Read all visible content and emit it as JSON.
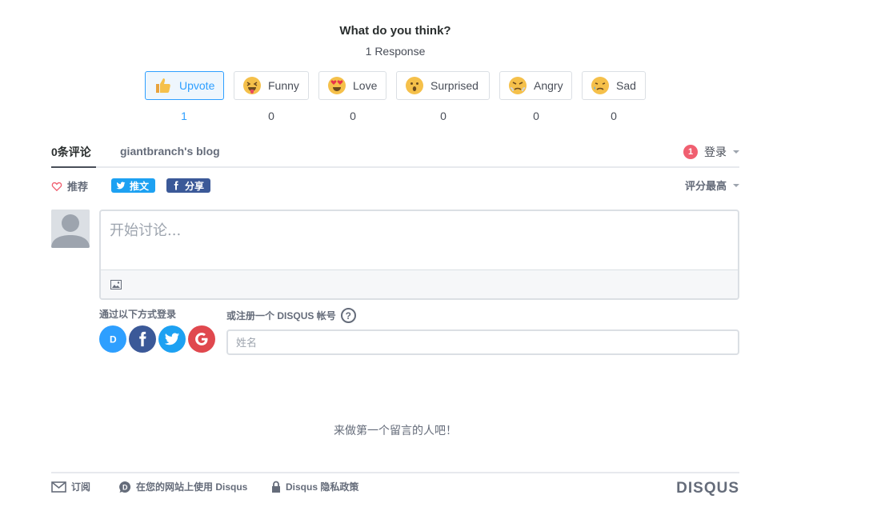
{
  "reactions_header": {
    "title": "What do you think?",
    "response_count": "1 Response"
  },
  "reactions": [
    {
      "label": "Upvote",
      "count": "1",
      "icon": "thumbs-up-icon",
      "selected": true
    },
    {
      "label": "Funny",
      "count": "0",
      "icon": "funny-face-icon"
    },
    {
      "label": "Love",
      "count": "0",
      "icon": "love-face-icon"
    },
    {
      "label": "Surprised",
      "count": "0",
      "icon": "surprised-face-icon"
    },
    {
      "label": "Angry",
      "count": "0",
      "icon": "angry-face-icon"
    },
    {
      "label": "Sad",
      "count": "0",
      "icon": "sad-face-icon"
    }
  ],
  "tabs": {
    "comments": "0条评论",
    "community": "giantbranch's blog",
    "login_badge": "1",
    "login": "登录"
  },
  "actions": {
    "recommend": "推荐",
    "tweet": "推文",
    "share": "分享",
    "sort": "评分最高"
  },
  "editor": {
    "placeholder": "开始讨论..."
  },
  "auth": {
    "login_via": "通过以下方式登录",
    "signup_prefix": "或注册一个 ",
    "signup_brand": "DISQUS",
    "signup_suffix": " 帐号",
    "help": "?",
    "name_placeholder": "姓名"
  },
  "empty_state": "来做第一个留言的人吧！",
  "footer": {
    "subscribe": "订阅",
    "add_disqus": "在您的网站上使用 Disqus",
    "privacy": "Disqus 隐私政策",
    "brand": "DISQUS"
  },
  "colors": {
    "accent": "#2e9fff",
    "badge": "#f05f70",
    "twitter": "#1da1f2",
    "facebook": "#3b5998",
    "disqus": "#2e9fff",
    "google": "#dd4b39",
    "text_muted": "#656c7a"
  }
}
